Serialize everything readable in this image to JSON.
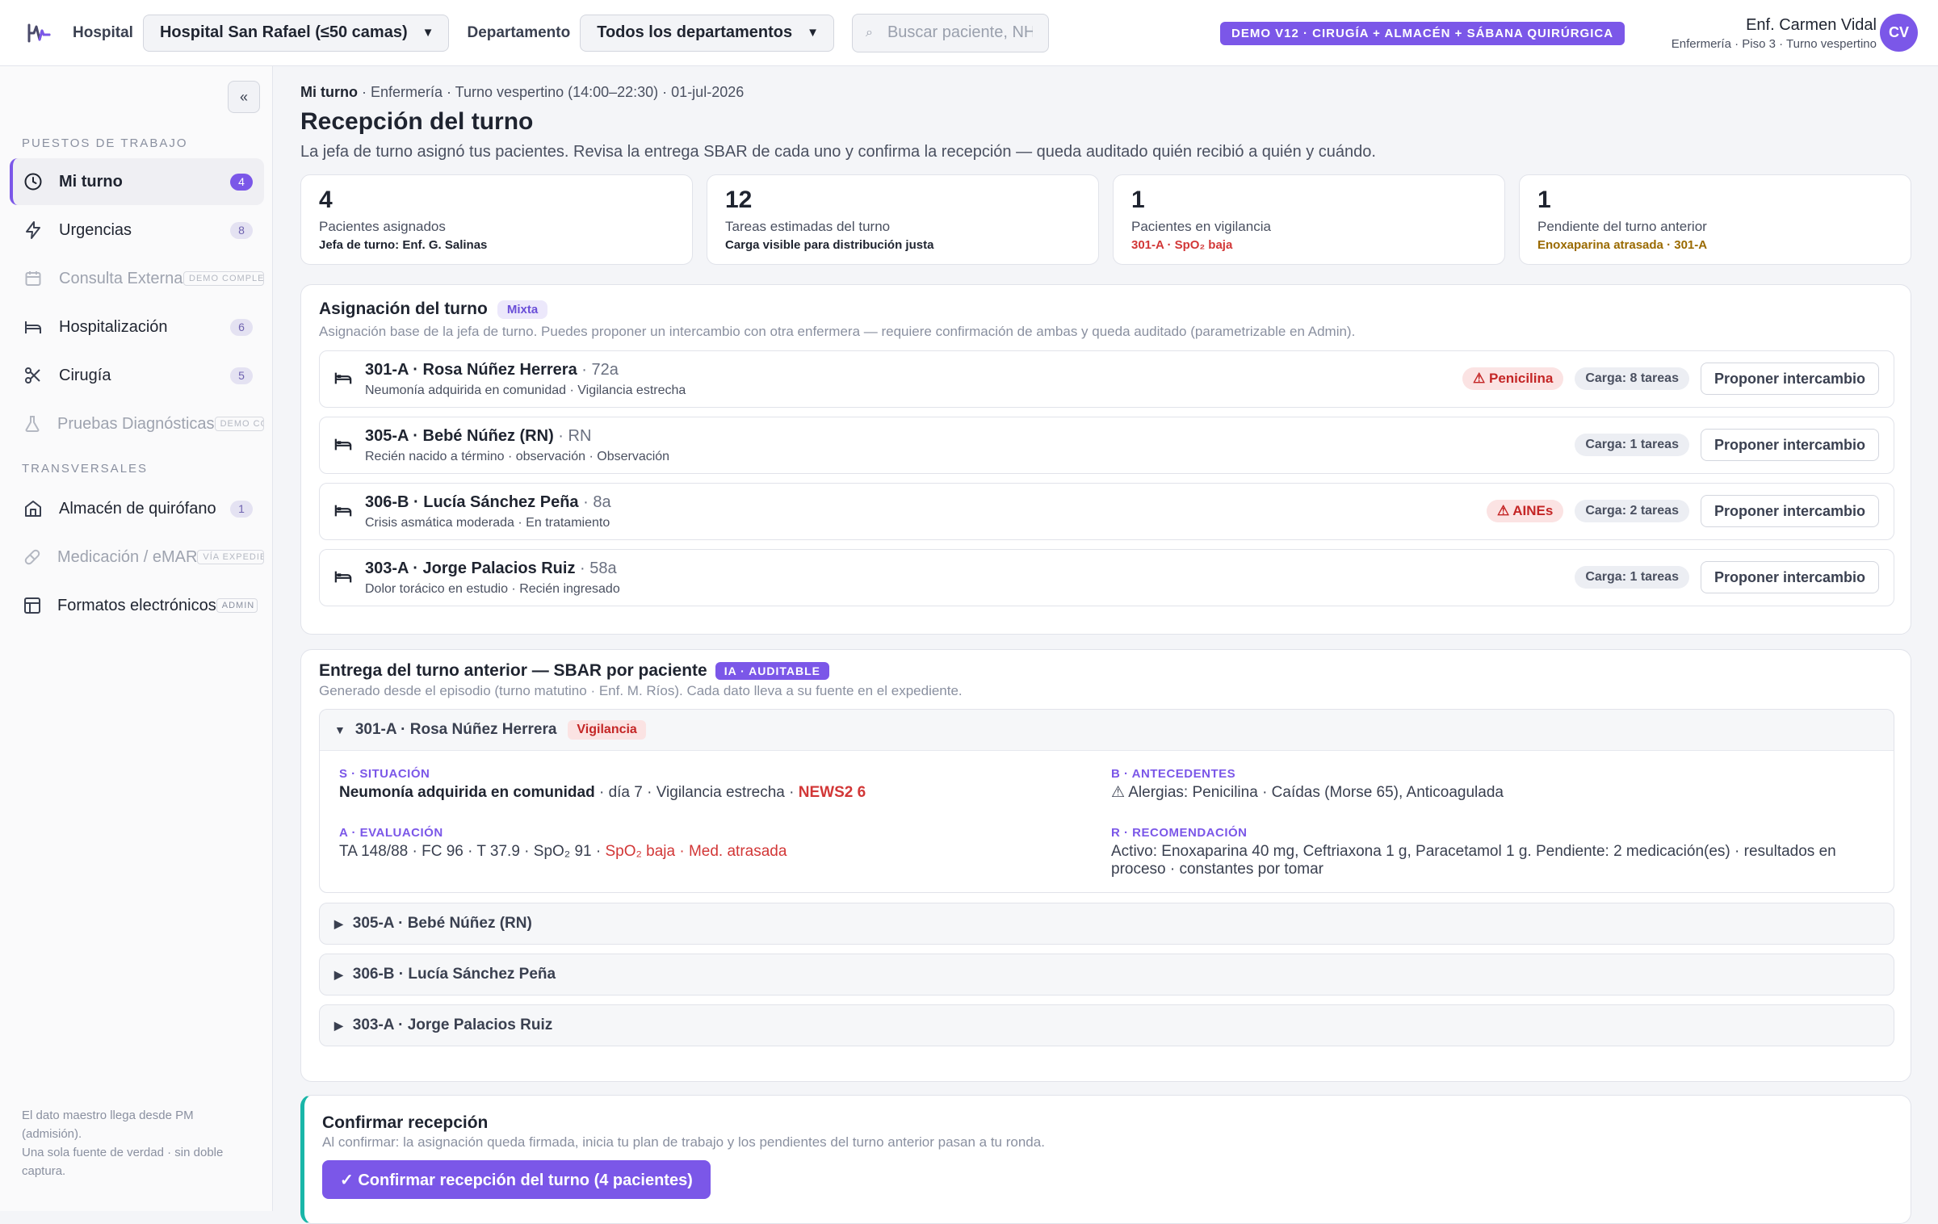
{
  "topbar": {
    "hospital_label": "Hospital",
    "hospital_value": "Hospital San Rafael (≤50 camas)",
    "department_label": "Departamento",
    "department_value": "Todos los departamentos",
    "search_placeholder": "Buscar paciente, NHC…",
    "demo_badge": "DEMO V12 · CIRUGÍA + ALMACÉN + SÁBANA QUIRÚRGICA",
    "user_name": "Enf. Carmen Vidal",
    "user_role": "Enfermería · Piso 3 · Turno vespertino",
    "avatar_initials": "CV"
  },
  "sidebar": {
    "collapse_label": "«",
    "section_work": "PUESTOS DE TRABAJO",
    "section_transversal": "TRANSVERSALES",
    "items": [
      {
        "label": "Mi turno",
        "count": "4"
      },
      {
        "label": "Urgencias",
        "count": "8"
      },
      {
        "label": "Consulta Externa",
        "tag": "DEMO COMPLETA"
      },
      {
        "label": "Hospitalización",
        "count": "6"
      },
      {
        "label": "Cirugía",
        "count": "5"
      },
      {
        "label": "Pruebas Diagnósticas",
        "tag": "DEMO COMPLETA"
      },
      {
        "label": "Almacén de quirófano",
        "count": "1"
      },
      {
        "label": "Medicación / eMAR",
        "tag": "VÍA EXPEDIENTE"
      },
      {
        "label": "Formatos electrónicos",
        "tag": "ADMIN"
      }
    ],
    "footer_line1": "El dato maestro llega desde PM (admisión).",
    "footer_line2": "Una sola fuente de verdad · sin doble captura."
  },
  "page": {
    "crumb_bold": "Mi turno",
    "crumb_rest": " · Enfermería · Turno vespertino (14:00–22:30) · 01-jul-2026",
    "title": "Recepción del turno",
    "subtitle": "La jefa de turno asignó tus pacientes. Revisa la entrega SBAR de cada uno y confirma la recepción — queda auditado quién recibió a quién y cuándo."
  },
  "stats": [
    {
      "num": "4",
      "label": "Pacientes asignados",
      "sub": "Jefa de turno: Enf. G. Salinas"
    },
    {
      "num": "12",
      "label": "Tareas estimadas del turno",
      "sub": "Carga visible para distribución justa"
    },
    {
      "num": "1",
      "label": "Pacientes en vigilancia",
      "sub": "301-A · SpO₂ baja"
    },
    {
      "num": "1",
      "label": "Pendiente del turno anterior",
      "sub": "Enoxaparina atrasada · 301-A"
    }
  ],
  "assignment": {
    "title": "Asignación del turno",
    "pill": "Mixta",
    "subtitle": "Asignación base de la jefa de turno. Puedes proponer un intercambio con otra enfermera — requiere confirmación de ambas y queda auditado (parametrizable en Admin).",
    "swap_label": "Proponer intercambio",
    "patients": [
      {
        "name": "301-A · Rosa Núñez Herrera",
        "age": " · 72a",
        "desc": "Neumonía adquirida en comunidad · Vigilancia estrecha",
        "allergy": "⚠ Penicilina",
        "load": "Carga: 8 tareas"
      },
      {
        "name": "305-A · Bebé Núñez (RN)",
        "age": " · RN",
        "desc": "Recién nacido a término · observación · Observación",
        "allergy": "",
        "load": "Carga: 1 tareas"
      },
      {
        "name": "306-B · Lucía Sánchez Peña",
        "age": " · 8a",
        "desc": "Crisis asmática moderada · En tratamiento",
        "allergy": "⚠ AINEs",
        "load": "Carga: 2 tareas"
      },
      {
        "name": "303-A · Jorge Palacios Ruiz",
        "age": " · 58a",
        "desc": "Dolor torácico en estudio · Recién ingresado",
        "allergy": "",
        "load": "Carga: 1 tareas"
      }
    ]
  },
  "handoff": {
    "title": "Entrega del turno anterior — SBAR por paciente",
    "pill": "IA · AUDITABLE",
    "subtitle": "Generado desde el episodio (turno matutino · Enf. M. Ríos). Cada dato lleva a su fuente en el expediente.",
    "open": {
      "head": "301-A · Rosa Núñez Herrera",
      "badge": "Vigilancia",
      "s_key": "S · SITUACIÓN",
      "s_main": "Neumonía adquirida en comunidad",
      "s_rest": " · día 7 · Vigilancia estrecha · ",
      "s_news": "NEWS2 6",
      "b_key": "B · ANTECEDENTES",
      "b_val": "⚠ Alergias: Penicilina · Caídas (Morse 65), Anticoagulada",
      "a_key": "A · EVALUACIÓN",
      "a_val": "TA 148/88 · FC 96 · T 37.9 · SpO₂ 91 · ",
      "a_red": "SpO₂ baja · Med. atrasada",
      "r_key": "R · RECOMENDACIÓN",
      "r_val": "Activo: Enoxaparina 40 mg, Ceftriaxona 1 g, Paracetamol 1 g. Pendiente: 2 medicación(es) · resultados en proceso · constantes por tomar"
    },
    "collapsed": [
      "305-A · Bebé Núñez (RN)",
      "306-B · Lucía Sánchez Peña",
      "303-A · Jorge Palacios Ruiz"
    ],
    "arrow_open": "▼",
    "arrow_closed": "▶"
  },
  "confirm": {
    "title": "Confirmar recepción",
    "subtitle": "Al confirmar: la asignación queda firmada, inicia tu plan de trabajo y los pendientes del turno anterior pasan a tu ronda.",
    "button": "✓ Confirmar recepción del turno (4 pacientes)"
  },
  "colors": {
    "accent": "#7b57e8",
    "danger": "#d23737",
    "warning": "#9a6a00",
    "confirm_border": "#19b6a8"
  }
}
